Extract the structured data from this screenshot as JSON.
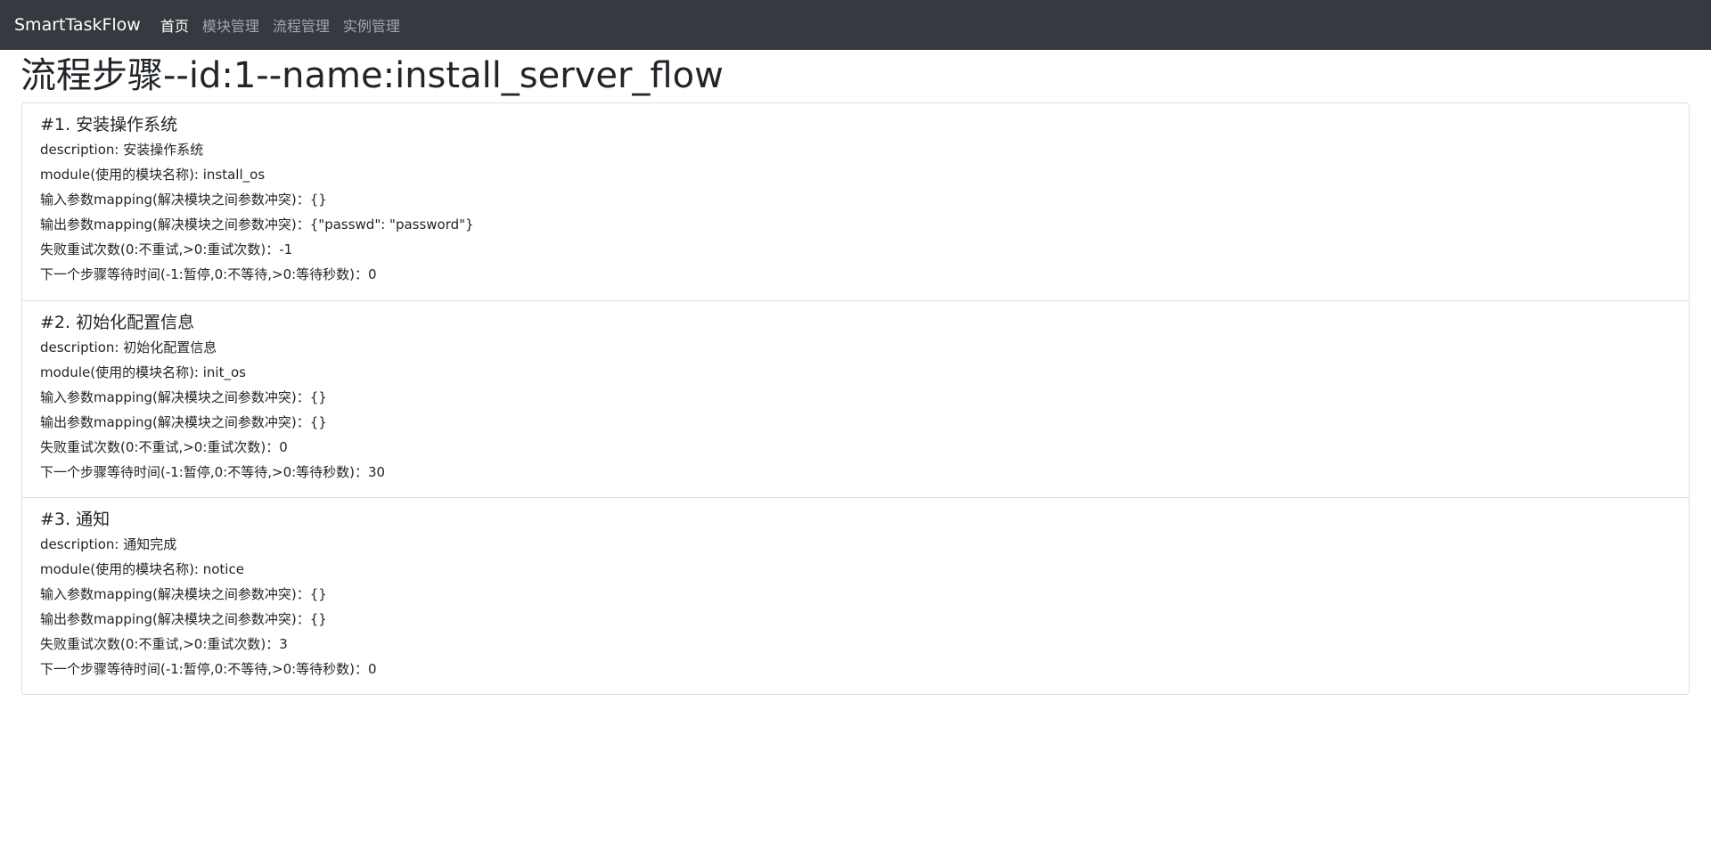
{
  "navbar": {
    "brand": "SmartTaskFlow",
    "items": [
      {
        "label": "首页",
        "active": true
      },
      {
        "label": "模块管理",
        "active": false
      },
      {
        "label": "流程管理",
        "active": false
      },
      {
        "label": "实例管理",
        "active": false
      }
    ]
  },
  "page_title": "流程步骤--id:1--name:install_server_flow",
  "steps": [
    {
      "title": "#1. 安装操作系统",
      "description": "description: 安装操作系统",
      "module": "module(使用的模块名称): install_os",
      "input_mapping": "输入参数mapping(解决模块之间参数冲突)：{}",
      "output_mapping": "输出参数mapping(解决模块之间参数冲突)：{\"passwd\": \"password\"}",
      "retry": "失败重试次数(0:不重试,>0:重试次数)：-1",
      "wait": "下一个步骤等待时间(-1:暂停,0:不等待,>0:等待秒数)：0"
    },
    {
      "title": "#2. 初始化配置信息",
      "description": "description: 初始化配置信息",
      "module": "module(使用的模块名称): init_os",
      "input_mapping": "输入参数mapping(解决模块之间参数冲突)：{}",
      "output_mapping": "输出参数mapping(解决模块之间参数冲突)：{}",
      "retry": "失败重试次数(0:不重试,>0:重试次数)：0",
      "wait": "下一个步骤等待时间(-1:暂停,0:不等待,>0:等待秒数)：30"
    },
    {
      "title": "#3. 通知",
      "description": "description: 通知完成",
      "module": "module(使用的模块名称): notice",
      "input_mapping": "输入参数mapping(解决模块之间参数冲突)：{}",
      "output_mapping": "输出参数mapping(解决模块之间参数冲突)：{}",
      "retry": "失败重试次数(0:不重试,>0:重试次数)：3",
      "wait": "下一个步骤等待时间(-1:暂停,0:不等待,>0:等待秒数)：0"
    }
  ]
}
